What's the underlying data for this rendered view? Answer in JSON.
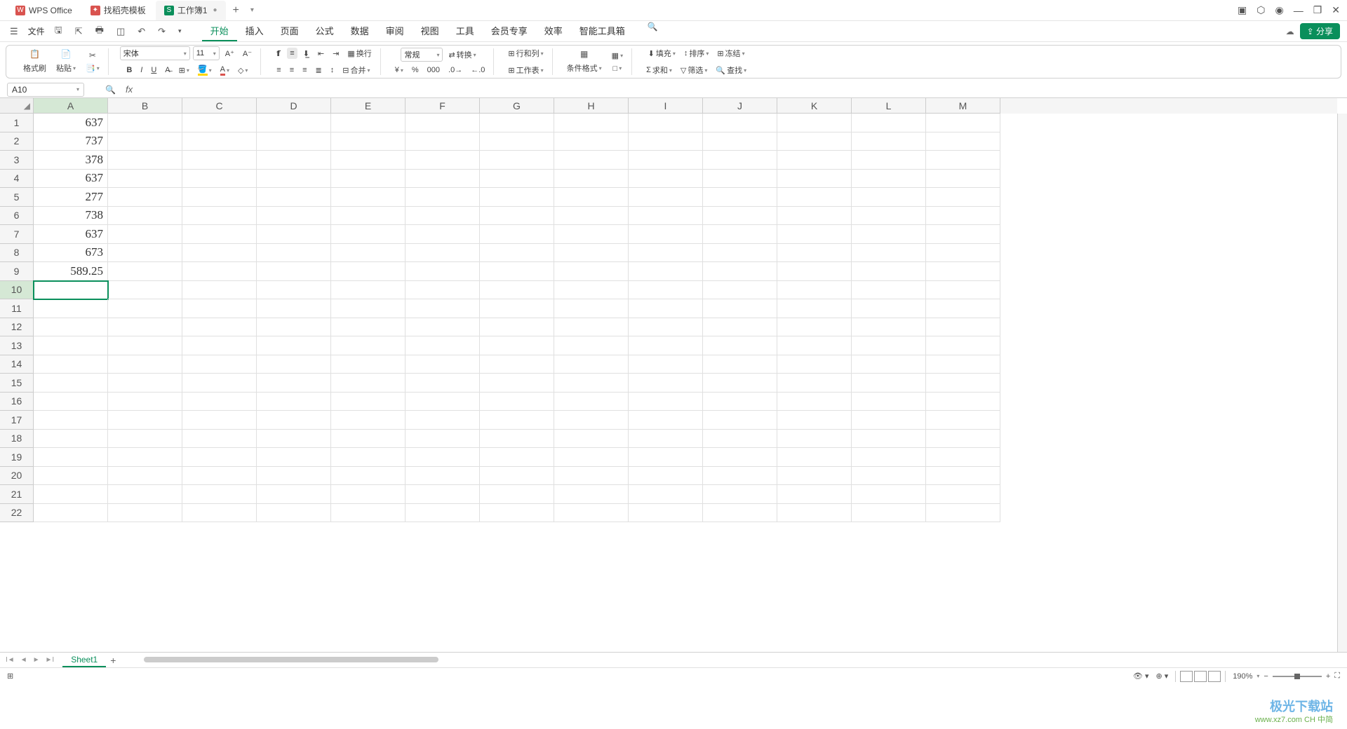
{
  "titlebar": {
    "tabs": [
      {
        "icon_bg": "#d9534f",
        "icon_txt": "W",
        "label": "WPS Office"
      },
      {
        "icon_bg": "#d9534f",
        "icon_txt": "✦",
        "label": "找稻壳模板"
      },
      {
        "icon_bg": "#0a8f5b",
        "icon_txt": "S",
        "label": "工作簿1"
      }
    ]
  },
  "menubar": {
    "file_label": "文件",
    "tabs": [
      "开始",
      "插入",
      "页面",
      "公式",
      "数据",
      "审阅",
      "视图",
      "工具",
      "会员专享",
      "效率",
      "智能工具箱"
    ],
    "active_index": 0,
    "share_label": "分享"
  },
  "ribbon": {
    "format_brush": "格式刷",
    "paste": "粘贴",
    "font_name": "宋体",
    "font_size": "11",
    "wrap": "换行",
    "merge": "合并",
    "number_format": "常规",
    "transpose": "转换",
    "rowcol": "行和列",
    "worksheet": "工作表",
    "cond_format": "条件格式",
    "fill": "填充",
    "sort": "排序",
    "freeze": "冻结",
    "sum": "求和",
    "filter": "筛选",
    "find": "查找"
  },
  "formula_bar": {
    "name_box": "A10"
  },
  "grid": {
    "columns": [
      "A",
      "B",
      "C",
      "D",
      "E",
      "F",
      "G",
      "H",
      "I",
      "J",
      "K",
      "L",
      "M"
    ],
    "row_count": 22,
    "selected_row": 10,
    "selected_col": 0,
    "data": {
      "A1": "637",
      "A2": "737",
      "A3": "378",
      "A4": "637",
      "A5": "277",
      "A6": "738",
      "A7": "637",
      "A8": "673",
      "A9": "589.25"
    }
  },
  "sheet_bar": {
    "sheet_name": "Sheet1"
  },
  "status_bar": {
    "zoom": "190%",
    "ime": "CH 中简"
  },
  "watermark": {
    "main": "极光下载站",
    "sub": "www.xz7.com"
  }
}
